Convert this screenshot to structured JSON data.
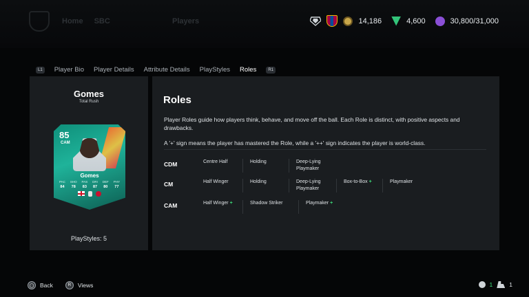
{
  "topbar": {
    "nav_items": [
      "Home",
      "SBC"
    ],
    "nav_secondary": "Players",
    "currencies": [
      {
        "icon": "coins-icon",
        "value": "14,186"
      },
      {
        "icon": "points-icon",
        "value": "4,600"
      },
      {
        "icon": "season-points-icon",
        "value": "30,800/31,000"
      }
    ]
  },
  "tabs": {
    "left_hint": "L1",
    "items": [
      "Player Bio",
      "Player Details",
      "Attribute Details",
      "PlayStyles",
      "Roles"
    ],
    "active": "Roles",
    "right_hint": "R1"
  },
  "player": {
    "name": "Gomes",
    "variant": "Total Rush",
    "rating": "85",
    "position": "CAM",
    "card_name": "Gomes",
    "stats": [
      {
        "label": "PAC",
        "value": "84"
      },
      {
        "label": "SHO",
        "value": "78"
      },
      {
        "label": "PAS",
        "value": "83"
      },
      {
        "label": "DRI",
        "value": "87"
      },
      {
        "label": "DEF",
        "value": "80"
      },
      {
        "label": "PHY",
        "value": "77"
      }
    ],
    "playstyles_count": "PlayStyles: 5"
  },
  "roles": {
    "title": "Roles",
    "description": "Player Roles guide how players think, behave, and move off the ball. Each Role is distinct, with positive aspects and drawbacks.",
    "legend": "A '+' sign means the player has mastered the Role, while a '++' sign indicates the player is world-class.",
    "rows": [
      {
        "position": "CDM",
        "roles": [
          {
            "name": "Centre Half",
            "plus": ""
          },
          {
            "name": "Holding",
            "plus": ""
          },
          {
            "name": "Deep-Lying Playmaker",
            "plus": ""
          }
        ]
      },
      {
        "position": "CM",
        "roles": [
          {
            "name": "Half Winger",
            "plus": ""
          },
          {
            "name": "Holding",
            "plus": ""
          },
          {
            "name": "Deep-Lying Playmaker",
            "plus": ""
          },
          {
            "name": "Box-to-Box",
            "plus": "+"
          },
          {
            "name": "Playmaker",
            "plus": ""
          }
        ]
      },
      {
        "position": "CAM",
        "roles": [
          {
            "name": "Half Winger",
            "plus": "+"
          },
          {
            "name": "Shadow Striker",
            "plus": ""
          },
          {
            "name": "Playmaker",
            "plus": "+"
          }
        ]
      }
    ]
  },
  "bottom": {
    "back_label": "Back",
    "back_button": "◯",
    "views_button": "R",
    "views_label": "Views",
    "online_count": "1",
    "friends_count": "1"
  },
  "colors": {
    "accent_green": "#3ee07c",
    "panel": "#1a1d20",
    "background": "#050607"
  }
}
